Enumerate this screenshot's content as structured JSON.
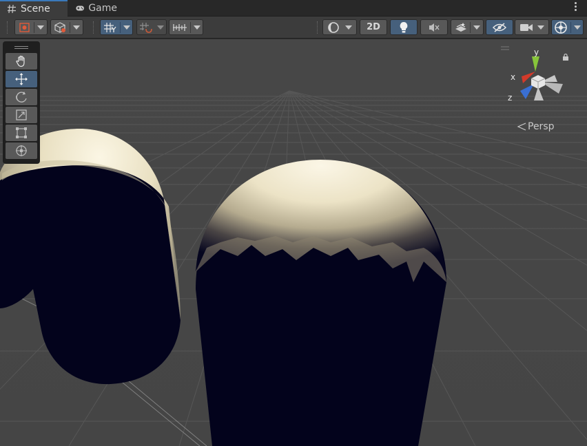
{
  "tabs": [
    {
      "label": "Scene",
      "icon": "hash-icon",
      "active": true
    },
    {
      "label": "Game",
      "icon": "gamepad-icon",
      "active": false
    }
  ],
  "toolbar": {
    "draw_mode_icon": "draw-mode-icon",
    "render_mode_icon": "cube-icon",
    "grid_snap_icon": "grid-snap-icon",
    "increment_snap_icon": "increment-snap-icon",
    "ruler_icon": "ruler-icon",
    "shading_icon": "shading-icon",
    "mode_2d_label": "2D",
    "lighting_icon": "lightbulb-icon",
    "audio_icon": "audio-mute-icon",
    "effects_icon": "effects-icon",
    "hidden_icon": "eye-slash-icon",
    "camera_icon": "camera-icon",
    "gizmos_icon": "gizmos-icon"
  },
  "tools": [
    {
      "name": "hand-tool",
      "icon": "hand-icon",
      "active": false
    },
    {
      "name": "move-tool",
      "icon": "move-arrows-icon",
      "active": true
    },
    {
      "name": "rotate-tool",
      "icon": "rotate-icon",
      "active": false
    },
    {
      "name": "scale-tool",
      "icon": "scale-icon",
      "active": false
    },
    {
      "name": "rect-tool",
      "icon": "rect-transform-icon",
      "active": false
    },
    {
      "name": "transform-tool",
      "icon": "transform-icon",
      "active": false
    }
  ],
  "gizmo": {
    "x_label": "x",
    "y_label": "y",
    "z_label": "z",
    "projection_label": "Persp",
    "colors": {
      "x": "#d33a2a",
      "y": "#87c53a",
      "z": "#3a6fd3"
    }
  },
  "colors": {
    "background": "#474747",
    "capsule_dark": "#03031c",
    "capsule_light": "#f3ecd4",
    "accent": "#46607c"
  }
}
